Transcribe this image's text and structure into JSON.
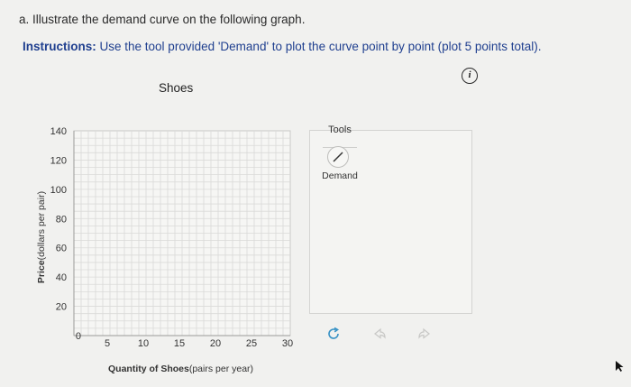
{
  "question": {
    "text": "a. Illustrate the demand curve on the following graph."
  },
  "instructions": {
    "prefix": "Instructions:",
    "text": " Use the tool provided 'Demand' to plot the curve point by point (plot 5 points total)."
  },
  "info_icon": "info-icon",
  "chart_data": {
    "type": "scatter",
    "title": "Shoes",
    "xlabel_bold": "Quantity of Shoes",
    "xlabel_units": "(pairs per year)",
    "ylabel_bold": "Price",
    "ylabel_units": "(dollars per pair)",
    "xlim": [
      0,
      30
    ],
    "ylim": [
      0,
      140
    ],
    "xticks": [
      0,
      5,
      10,
      15,
      20,
      25,
      30
    ],
    "yticks": [
      0,
      20,
      40,
      60,
      80,
      100,
      120,
      140
    ],
    "grid": true,
    "series": []
  },
  "tools": {
    "title": "Tools",
    "demand_label": "Demand",
    "demand_icon": "line-pencil-icon",
    "actions": [
      "reset-icon",
      "undo-icon",
      "redo-icon"
    ]
  }
}
